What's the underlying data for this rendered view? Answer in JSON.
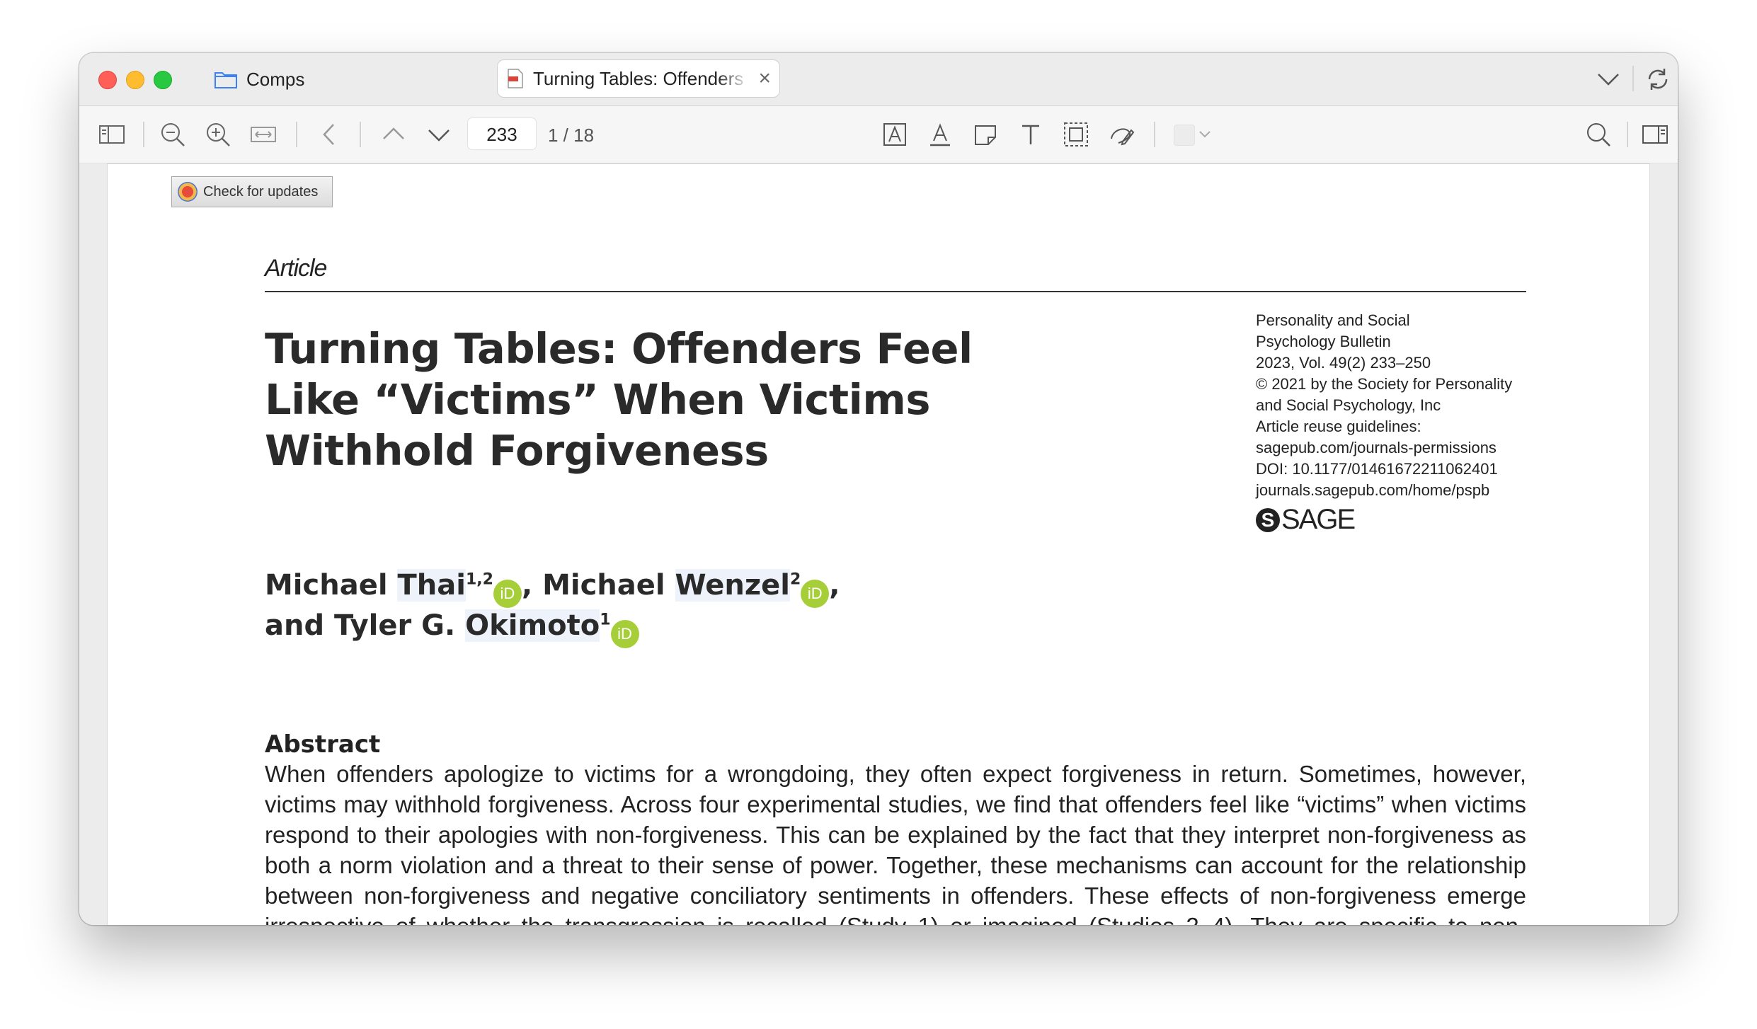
{
  "tabs": [
    {
      "label": "Comps",
      "icon": "folder-icon"
    },
    {
      "label": "Turning Tables: Offenders Feel Like",
      "icon": "pdf-icon",
      "active": true
    }
  ],
  "toolbar": {
    "page_input_value": "233",
    "page_count": "1 / 18"
  },
  "document": {
    "update_button_label": "Check for updates",
    "article_label": "Article",
    "title": "Turning Tables: Offenders Feel Like “Victims” When Victims Withhold Forgiveness",
    "meta_lines": [
      "Personality and Social",
      "Psychology Bulletin",
      "2023, Vol. 49(2) 233–250",
      "© 2021 by the Society for Personality",
      "and Social Psychology, Inc",
      "Article reuse guidelines:",
      "sagepub.com/journals-permissions",
      "DOI: 10.1177/01461672211062401",
      "journals.sagepub.com/home/pspb"
    ],
    "publisher_logo": "SAGE",
    "authors": {
      "a1_first": "Michael",
      "a1_last": "Thai",
      "a1_sup": "1,2",
      "a2_first": "Michael",
      "a2_last": "Wenzel",
      "a2_sup": "2",
      "and": "and",
      "a3_first": "Tyler G.",
      "a3_last": "Okimoto",
      "a3_sup": "1",
      "orcid_label": "iD"
    },
    "abstract_title": "Abstract",
    "abstract_text": "When offenders apologize to victims for a wrongdoing, they often expect forgiveness in return. Sometimes, however, victims may withhold forgiveness. Across four experimental studies, we find that offenders feel like “victims” when victims respond to their apologies with non-forgiveness. This can be explained by the fact that they interpret non-forgiveness as both a norm violation and a threat to their sense of power. Together, these mechanisms can account for the relationship between non-forgiveness and negative conciliatory sentiments in offenders. These effects of non-forgiveness emerge irrespective of whether the transgression is recalled (Study 1) or imagined (Studies 2–4). They are specific to non-forgiveness rather than"
  }
}
